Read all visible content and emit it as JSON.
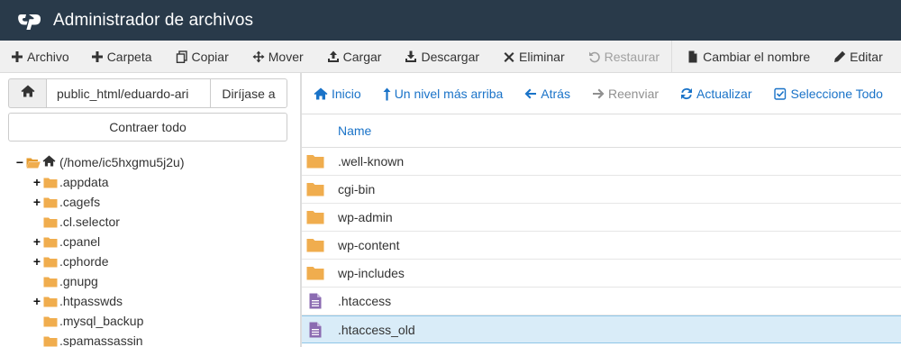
{
  "header": {
    "title": "Administrador de archivos",
    "logo_icon": "cpanel-logo-icon"
  },
  "toolbar": {
    "file": "Archivo",
    "folder": "Carpeta",
    "copy": "Copiar",
    "move": "Mover",
    "upload": "Cargar",
    "download": "Descargar",
    "delete": "Eliminar",
    "restore": "Restaurar",
    "rename": "Cambiar el nombre",
    "edit": "Editar"
  },
  "left": {
    "path_value": "public_html/eduardo-ari",
    "go_label": "Diríjase a",
    "collapse_label": "Contraer todo",
    "root": "(/home/ic5hxgmu5j2u)",
    "tree": [
      {
        "label": ".appdata",
        "expandable": "+"
      },
      {
        "label": ".cagefs",
        "expandable": "+"
      },
      {
        "label": ".cl.selector",
        "expandable": ""
      },
      {
        "label": ".cpanel",
        "expandable": "+"
      },
      {
        "label": ".cphorde",
        "expandable": "+"
      },
      {
        "label": ".gnupg",
        "expandable": ""
      },
      {
        "label": ".htpasswds",
        "expandable": "+"
      },
      {
        "label": ".mysql_backup",
        "expandable": ""
      },
      {
        "label": ".spamassassin",
        "expandable": ""
      }
    ]
  },
  "nav": {
    "home": "Inicio",
    "up": "Un nivel más arriba",
    "back": "Atrás",
    "forward": "Reenviar",
    "refresh": "Actualizar",
    "select_all": "Seleccione Todo"
  },
  "table": {
    "name_header": "Name",
    "rows": [
      {
        "name": ".well-known",
        "type": "folder"
      },
      {
        "name": "cgi-bin",
        "type": "folder"
      },
      {
        "name": "wp-admin",
        "type": "folder"
      },
      {
        "name": "wp-content",
        "type": "folder"
      },
      {
        "name": "wp-includes",
        "type": "folder"
      },
      {
        "name": ".htaccess",
        "type": "file"
      },
      {
        "name": ".htaccess_old",
        "type": "file",
        "selected": true
      }
    ]
  },
  "colors": {
    "header_bg": "#293a4a",
    "link": "#1a73c8",
    "folder": "#f0ad4e",
    "file": "#8b6bb1",
    "selected_row": "#d9ecf8"
  }
}
